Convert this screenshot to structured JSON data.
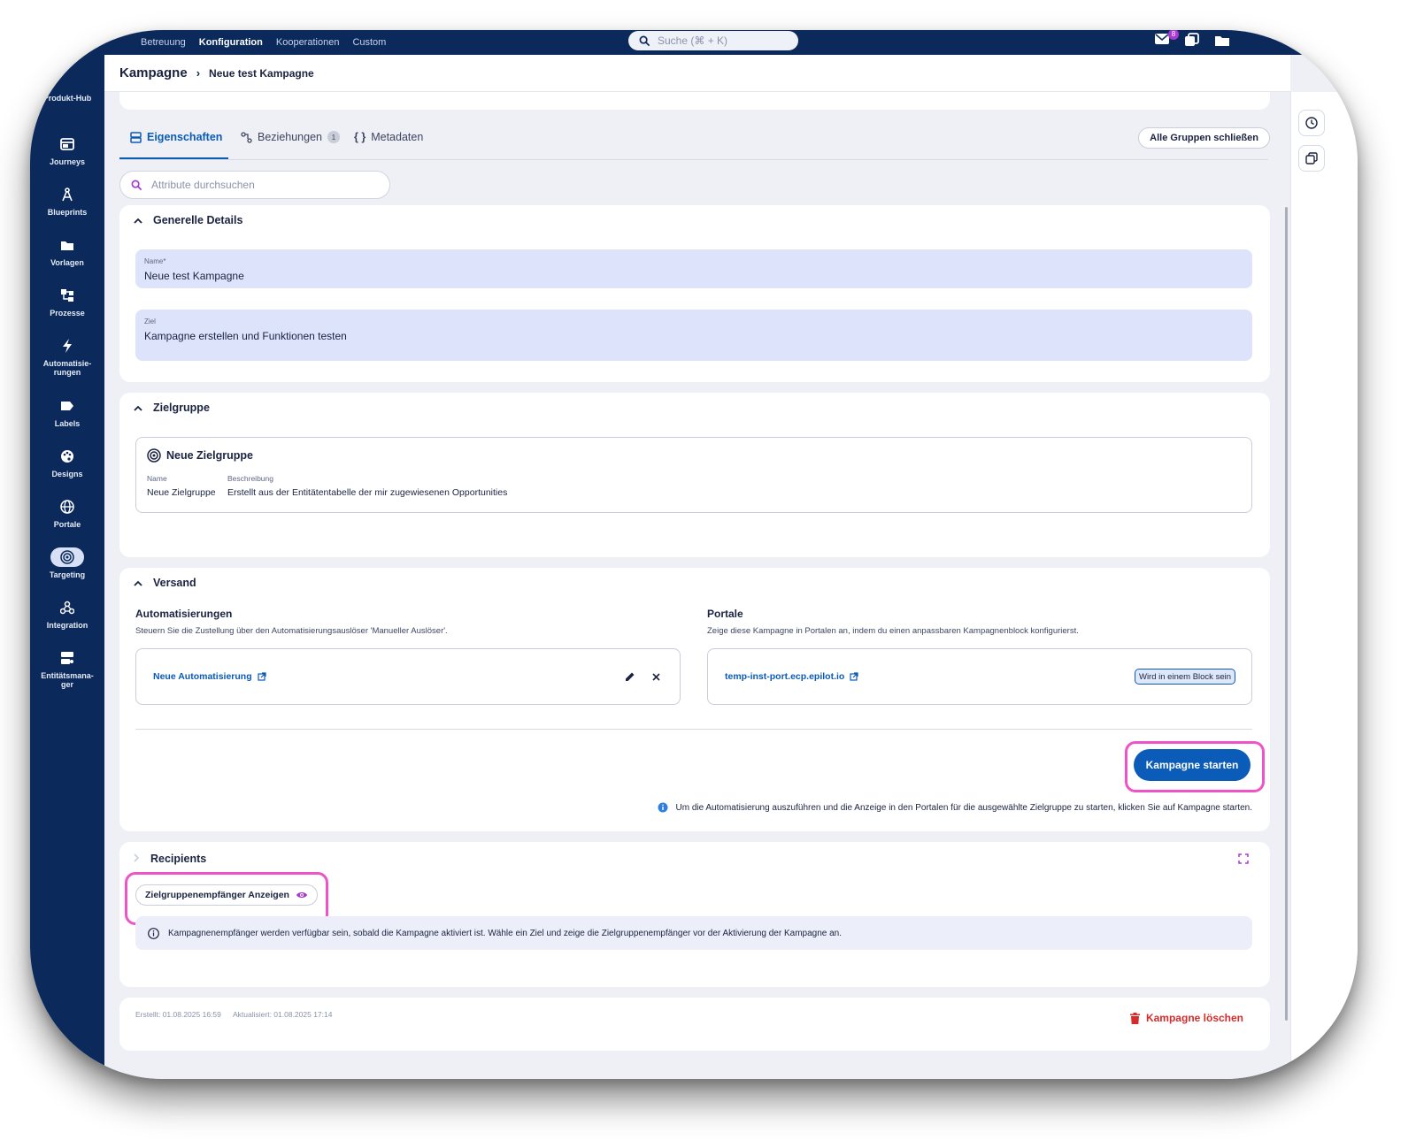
{
  "topnav": {
    "items": [
      "Betreuung",
      "Konfiguration",
      "Kooperationen",
      "Custom"
    ],
    "active": "Konfiguration"
  },
  "search": {
    "placeholder": "Suche (⌘ + K)"
  },
  "notifications": {
    "mail_count": "8"
  },
  "sidebar": {
    "items": [
      {
        "label": "Produkt-Hub",
        "icon": "package-icon"
      },
      {
        "label": "Journeys",
        "icon": "journeys-icon"
      },
      {
        "label": "Blueprints",
        "icon": "compass-icon"
      },
      {
        "label": "Vorlagen",
        "icon": "folder-icon"
      },
      {
        "label": "Prozesse",
        "icon": "process-icon"
      },
      {
        "label": "Automatisie-rungen",
        "icon": "lightning-icon"
      },
      {
        "label": "Labels",
        "icon": "label-icon"
      },
      {
        "label": "Designs",
        "icon": "palette-icon"
      },
      {
        "label": "Portale",
        "icon": "globe-icon"
      },
      {
        "label": "Targeting",
        "icon": "target-icon"
      },
      {
        "label": "Integration",
        "icon": "webhook-icon"
      },
      {
        "label": "Entitätsmana-ger",
        "icon": "entity-icon"
      }
    ],
    "active": "Targeting"
  },
  "breadcrumb": {
    "root": "Kampagne",
    "leaf": "Neue test Kampagne"
  },
  "tabs": {
    "items": [
      {
        "label": "Eigenschaften",
        "icon": "properties-icon"
      },
      {
        "label": "Beziehungen",
        "icon": "relations-icon",
        "count": "1"
      },
      {
        "label": "Metadaten",
        "icon": "braces-icon"
      }
    ],
    "active": "Eigenschaften",
    "close_all_label": "Alle Gruppen schließen"
  },
  "attribute_search": {
    "placeholder": "Attribute durchsuchen"
  },
  "general": {
    "title": "Generelle Details",
    "name_label": "Name*",
    "name_value": "Neue test Kampagne",
    "goal_label": "Ziel",
    "goal_value": "Kampagne erstellen und Funktionen testen"
  },
  "target_group": {
    "title": "Zielgruppe",
    "card_title": "Neue Zielgruppe",
    "col_name": "Name",
    "col_desc": "Beschreibung",
    "name_value": "Neue Zielgruppe",
    "desc_value": "Erstellt aus der Entitätentabelle der mir zugewiesenen Opportunities"
  },
  "dispatch": {
    "title": "Versand",
    "automations_title": "Automatisierungen",
    "automations_desc": "Steuern Sie die Zustellung über den Automatisierungsauslöser 'Manueller Auslöser'.",
    "automation_link": "Neue Automatisierung",
    "portals_title": "Portale",
    "portals_desc": "Zeige diese Kampagne in Portalen an, indem du einen anpassbaren Kampagnenblock konfigurierst.",
    "portal_link": "temp-inst-port.ecp.epilot.io",
    "portal_badge": "Wird in einem Block sein",
    "start_label": "Kampagne starten",
    "start_info": "Um die Automatisierung auszuführen und die Anzeige in den Portalen für die ausgewählte Zielgruppe zu starten, klicken Sie auf Kampagne starten."
  },
  "recipients": {
    "title": "Recipients",
    "show_label": "Zielgruppenempfänger Anzeigen",
    "info": "Kampagnenempfänger werden verfügbar sein, sobald die Kampagne aktiviert ist. Wähle ein Ziel und zeige die Zielgruppenempfänger vor der Aktivierung der Kampagne an."
  },
  "footer": {
    "created": "Erstellt: 01.08.2025 16:59",
    "updated": "Aktualisiert: 01.08.2025 17:14",
    "delete_label": "Kampagne löschen"
  },
  "colors": {
    "primary": "#0b5cb8",
    "nav": "#0b2a5b",
    "highlight": "#f053c8",
    "danger": "#d42b2b",
    "field_bg": "#dde3fb"
  }
}
